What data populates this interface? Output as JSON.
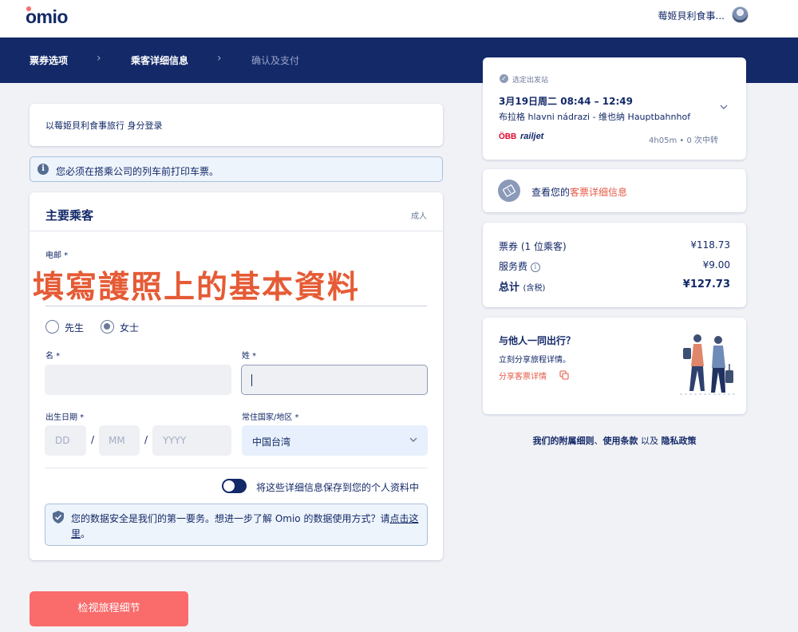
{
  "header": {
    "logo": "omio",
    "user_name": "莓姬貝利食事..."
  },
  "steps": [
    {
      "label": "票券选项",
      "state": "done"
    },
    {
      "label": "乘客详细信息",
      "state": "active"
    },
    {
      "label": "确认及支付",
      "state": "upcoming"
    }
  ],
  "login_status": "以莓姬貝利食事旅行 身分登录",
  "notice": "您必须在搭乘公司的列车前打印车票。",
  "form": {
    "title": "主要乘客",
    "passenger_type": "成人",
    "email_label": "电邮 *",
    "overlay_caption": "填寫護照上的基本資料",
    "title_options": [
      "先生",
      "女士"
    ],
    "selected_title": "女士",
    "first_name_label": "名 *",
    "last_name_label": "姓 *",
    "dob_label": "出生日期 *",
    "dob_placeholders": {
      "day": "DD",
      "month": "MM",
      "year": "YYYY"
    },
    "dob_separator": "/",
    "residence_label": "常住国家/地区 *",
    "residence_value": "中国台湾",
    "save_toggle_label": "将这些详细信息保存到您的个人资料中",
    "security_text": "您的数据安全是我们的第一要务。想进一步了解 Omio 的数据使用方式？请",
    "security_link": "点击这里",
    "security_end": "。"
  },
  "cta_label": "检视旅程细节",
  "trip": {
    "selected_label": "选定出发站",
    "datetime": "3月19日周二   08:44 – 12:49",
    "route": "布拉格 hlavni nádrazi  -  维也纳 Hauptbahnhof",
    "operator_obb": "ÖBB",
    "operator_railjet": "railjet",
    "duration": "4h05m • 0 次中转"
  },
  "ticket_details": {
    "prefix": "查看您的",
    "link": "客票详细信息"
  },
  "pricing": {
    "ticket_label": "票券 (1 位乘客)",
    "ticket_value": "¥118.73",
    "fee_label": "服务费",
    "fee_value": "¥9.00",
    "total_label": "总计",
    "total_note": "(含税)",
    "total_value": "¥127.73"
  },
  "share": {
    "title": "与他人一同出行？",
    "subtitle": "立刻分享旅程详情。",
    "link": "分享客票详情"
  },
  "terms": {
    "part1": "我们的附属细则",
    "sep1": "、",
    "part2": "使用条款",
    "sep2": " 以及 ",
    "part3": "隐私政策"
  },
  "colors": {
    "navy": "#132968",
    "accent_red": "#fa6b6b",
    "link_red": "#e55b47",
    "overlay_orange": "#e55b35"
  }
}
